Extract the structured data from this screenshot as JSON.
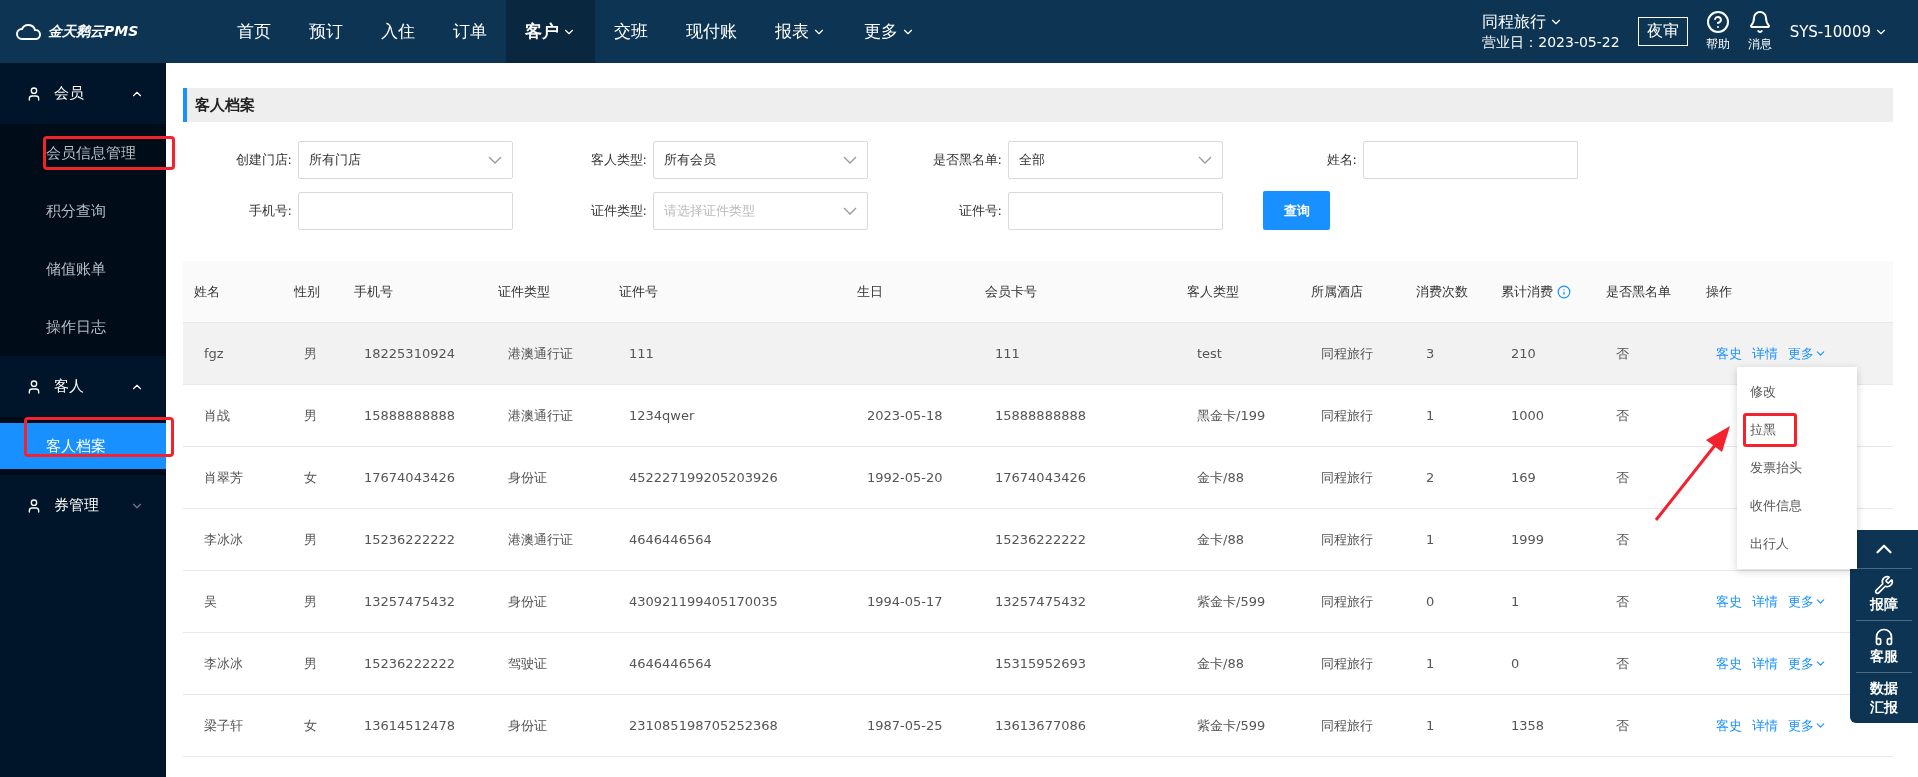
{
  "brand": {
    "name": "金天鹅云PMS"
  },
  "nav": [
    {
      "label": "首页",
      "selected": false,
      "has_menu": false
    },
    {
      "label": "预订",
      "selected": false,
      "has_menu": false
    },
    {
      "label": "入住",
      "selected": false,
      "has_menu": false
    },
    {
      "label": "订单",
      "selected": false,
      "has_menu": false
    },
    {
      "label": "客户",
      "selected": true,
      "has_menu": true
    },
    {
      "label": "交班",
      "selected": false,
      "has_menu": false
    },
    {
      "label": "现付账",
      "selected": false,
      "has_menu": false
    },
    {
      "label": "报表",
      "selected": false,
      "has_menu": true
    },
    {
      "label": "更多",
      "selected": false,
      "has_menu": true
    }
  ],
  "hotel": {
    "name": "同程旅行",
    "business_day": "营业日：2023-05-22"
  },
  "night_audit": "夜审",
  "help": "帮助",
  "messages": "消息",
  "user": "SYS-10009",
  "sidebar": [
    {
      "label": "会员",
      "expanded": true,
      "children": [
        {
          "label": "会员信息管理",
          "selected": false,
          "highlighted": true
        },
        {
          "label": "积分查询",
          "selected": false,
          "highlighted": false
        },
        {
          "label": "储值账单",
          "selected": false,
          "highlighted": false
        },
        {
          "label": "操作日志",
          "selected": false,
          "highlighted": false
        }
      ]
    },
    {
      "label": "客人",
      "expanded": true,
      "children": [
        {
          "label": "客人档案",
          "selected": true,
          "highlighted": true
        }
      ]
    },
    {
      "label": "券管理",
      "expanded": false
    }
  ],
  "page_title": "客人档案",
  "filters": [
    {
      "label": "创建门店:",
      "kind": "select",
      "value": "所有门店"
    },
    {
      "label": "客人类型:",
      "kind": "select",
      "value": "所有会员"
    },
    {
      "label": "是否黑名单:",
      "kind": "select",
      "value": "全部"
    },
    {
      "label": "姓名:",
      "kind": "input"
    },
    {
      "label": "手机号:",
      "kind": "input"
    },
    {
      "label": "证件类型:",
      "kind": "select",
      "placeholder": "请选择证件类型"
    },
    {
      "label": "证件号:",
      "kind": "input"
    }
  ],
  "search_button": "查询",
  "table": {
    "columns": [
      "姓名",
      "性别",
      "手机号",
      "证件类型",
      "证件号",
      "生日",
      "会员卡号",
      "客人类型",
      "所属酒店",
      "消费次数",
      "累计消费",
      "是否黑名单",
      "操作"
    ],
    "rows": [
      {
        "cells": [
          "fgz",
          "男",
          "18225310924",
          "港澳通行证",
          "111",
          "",
          "111",
          "test",
          "同程旅行",
          "3",
          "210",
          "否"
        ],
        "hovered": true,
        "actions": [
          "客史",
          "详情",
          "更多"
        ]
      },
      {
        "cells": [
          "肖战",
          "男",
          "15888888888",
          "港澳通行证",
          "1234qwer",
          "2023-05-18",
          "15888888888",
          "黑金卡/199",
          "同程旅行",
          "1",
          "1000",
          "否"
        ],
        "hovered": false,
        "actions": []
      },
      {
        "cells": [
          "肖翠芳",
          "女",
          "17674043426",
          "身份证",
          "452227199205203926",
          "1992-05-20",
          "17674043426",
          "金卡/88",
          "同程旅行",
          "2",
          "169",
          "否"
        ],
        "hovered": false,
        "actions": []
      },
      {
        "cells": [
          "李冰冰",
          "男",
          "15236222222",
          "港澳通行证",
          "4646446564",
          "",
          "15236222222",
          "金卡/88",
          "同程旅行",
          "1",
          "1999",
          "否"
        ],
        "hovered": false,
        "actions": []
      },
      {
        "cells": [
          "吴",
          "男",
          "13257475432",
          "身份证",
          "430921199405170035",
          "1994-05-17",
          "13257475432",
          "紫金卡/599",
          "同程旅行",
          "0",
          "1",
          "否"
        ],
        "hovered": false,
        "actions": [
          "客史",
          "详情",
          "更多"
        ]
      },
      {
        "cells": [
          "李冰冰",
          "男",
          "15236222222",
          "驾驶证",
          "4646446564",
          "",
          "15315952693",
          "金卡/88",
          "同程旅行",
          "1",
          "0",
          "否"
        ],
        "hovered": false,
        "actions": [
          "客史",
          "详情",
          "更多"
        ]
      },
      {
        "cells": [
          "梁子轩",
          "女",
          "13614512478",
          "身份证",
          "231085198705252368",
          "1987-05-25",
          "13613677086",
          "紫金卡/599",
          "同程旅行",
          "1",
          "1358",
          "否"
        ],
        "hovered": false,
        "actions": [
          "客史",
          "详情",
          "更多"
        ]
      }
    ]
  },
  "more_menu": [
    {
      "label": "修改",
      "highlighted": false
    },
    {
      "label": "拉黑",
      "highlighted": true
    },
    {
      "label": "发票抬头",
      "highlighted": false
    },
    {
      "label": "收件信息",
      "highlighted": false
    },
    {
      "label": "出行人",
      "highlighted": false
    }
  ],
  "side_tools": [
    {
      "kind": "top"
    },
    {
      "kind": "wrench",
      "label": "报障"
    },
    {
      "kind": "headset",
      "label": "客服"
    },
    {
      "kind": "text",
      "label": "数据汇报"
    }
  ]
}
